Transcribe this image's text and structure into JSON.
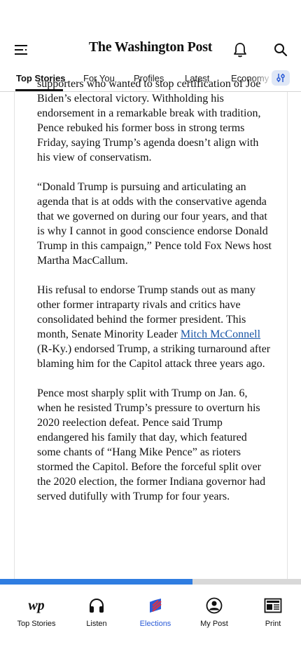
{
  "header": {
    "logo_text": "The Washington Post"
  },
  "tabs": [
    {
      "label": "Top Stories",
      "active": true
    },
    {
      "label": "For You",
      "active": false
    },
    {
      "label": "Profiles",
      "active": false
    },
    {
      "label": "Latest",
      "active": false
    },
    {
      "label": "Economy",
      "active": false
    }
  ],
  "article": {
    "p1": "supporters who wanted to stop certification of Joe Biden’s electoral victory. Withholding his endorsement in a remarkable break with tradition, Pence rebuked his former boss in strong terms Friday, saying Trump’s agenda doesn’t align with his view of conservatism.",
    "p2": "“Donald Trump is pursuing and articulating an agenda that is at odds with the conservative agenda that we governed on during our four years, and that is why I cannot in good conscience endorse Donald Trump in this campaign,” Pence told Fox News host Martha MacCallum.",
    "p3_before": "His refusal to endorse Trump stands out as many other former intraparty rivals and critics have consolidated behind the former president. This month, Senate Minority Leader ",
    "p3_link": "Mitch McConnell",
    "p3_after": " (R-Ky.) endorsed Trump, a striking turnaround after blaming him for the Capitol attack three years ago.",
    "p4": "Pence most sharply split with Trump on Jan. 6, when he resisted Trump’s pressure to overturn his 2020 reelection defeat. Pence said Trump endangered his family that day, which featured some chants of “Hang Mike Pence” as rioters stormed the Capitol. Before the forceful split over the 2020 election, the former Indiana governor had served dutifully with Trump for four years."
  },
  "progress": {
    "fraction": 0.64
  },
  "bottom_nav": [
    {
      "label": "Top Stories",
      "icon": "wp-logo-icon",
      "active": false
    },
    {
      "label": "Listen",
      "icon": "headphones-icon",
      "active": false
    },
    {
      "label": "Elections",
      "icon": "elections-flag-icon",
      "active": true
    },
    {
      "label": "My Post",
      "icon": "user-circle-icon",
      "active": false
    },
    {
      "label": "Print",
      "icon": "newspaper-icon",
      "active": false
    }
  ],
  "colors": {
    "accent": "#2a5bd7",
    "progress": "#2f7de1",
    "link": "#1955a5",
    "flag_red": "#d6344a",
    "flag_blue": "#2a5bd7"
  }
}
